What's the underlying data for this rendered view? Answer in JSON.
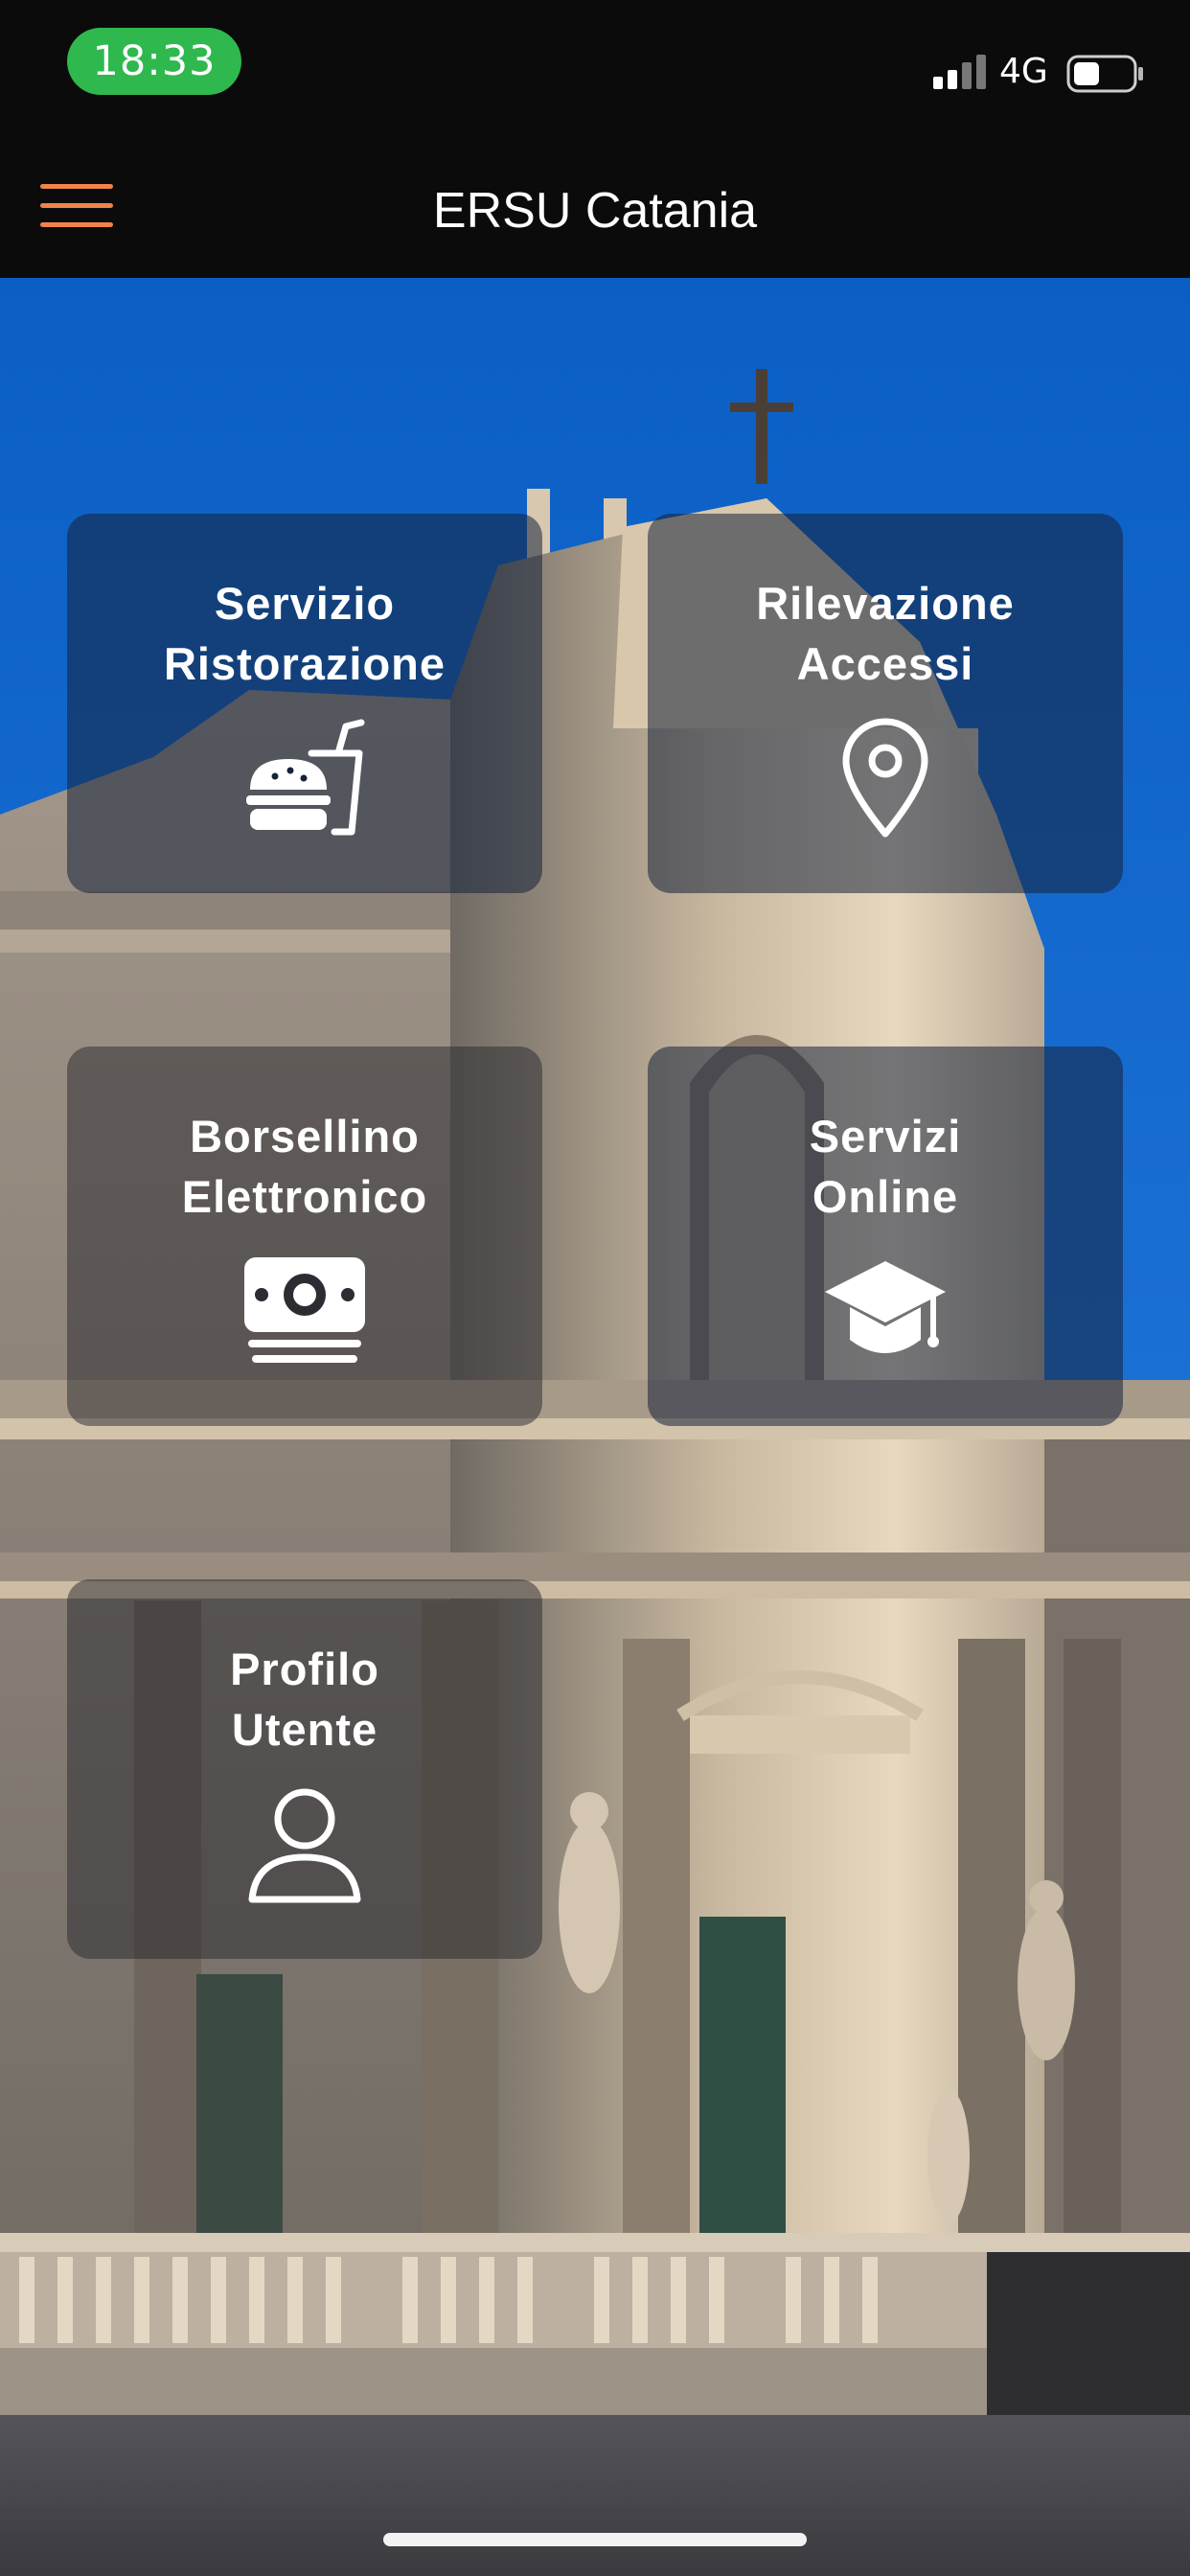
{
  "status_bar": {
    "time": "18:33",
    "network": "4G",
    "time_pill_color": "#2fb84e",
    "icons": [
      "signal-icon",
      "battery-icon"
    ]
  },
  "nav": {
    "title": "ERSU Catania",
    "menu_icon": "hamburger-menu-icon",
    "accent_color": "#f0834a"
  },
  "tiles": [
    {
      "id": "ristorazione",
      "line1": "Servizio",
      "line2": "Ristorazione",
      "icon": "food-drink-icon"
    },
    {
      "id": "accessi",
      "line1": "Rilevazione",
      "line2": "Accessi",
      "icon": "location-pin-icon"
    },
    {
      "id": "borsellino",
      "line1": "Borsellino",
      "line2": "Elettronico",
      "icon": "money-icon"
    },
    {
      "id": "online",
      "line1": "Servizi",
      "line2": "Online",
      "icon": "graduation-cap-icon"
    },
    {
      "id": "profilo",
      "line1": "Profilo",
      "line2": "Utente",
      "icon": "user-icon"
    }
  ]
}
